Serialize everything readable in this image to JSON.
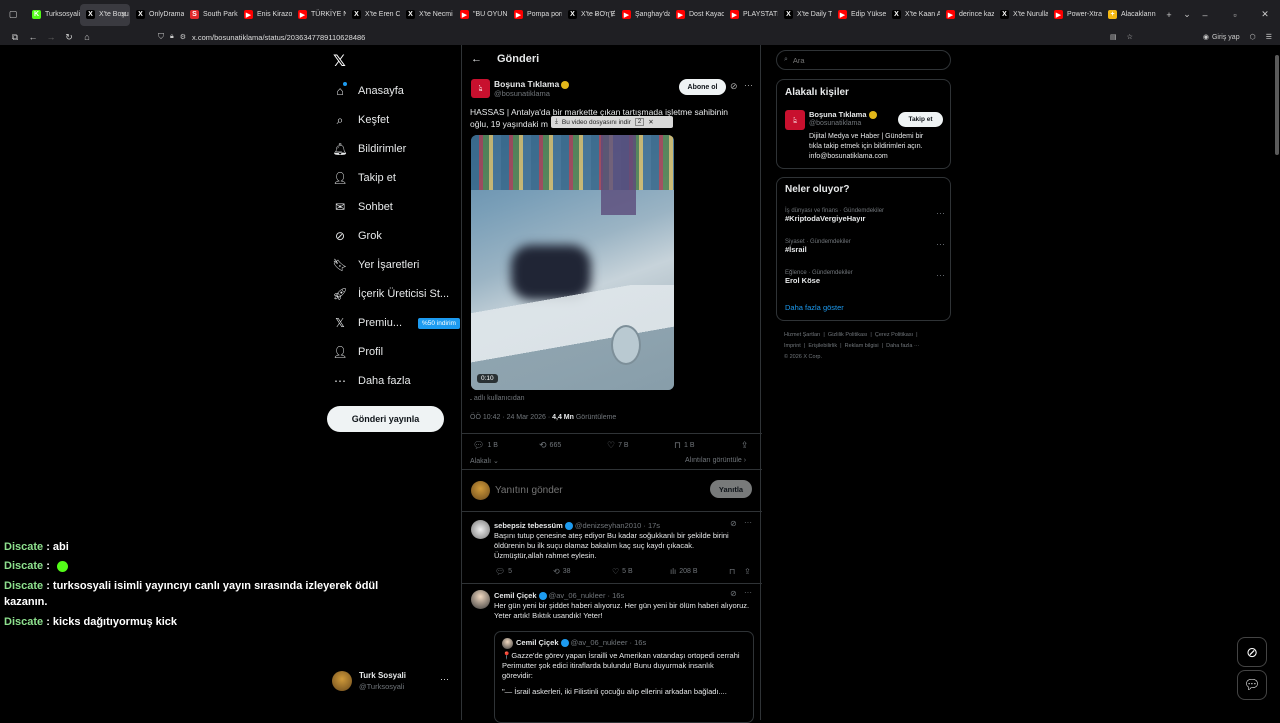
{
  "browser": {
    "tabs": [
      {
        "label": "Turksosyali",
        "color": "#53fc18",
        "glyph": "K"
      },
      {
        "label": "X'te Boşu",
        "color": "#000000",
        "glyph": "X"
      },
      {
        "label": "OnlyDrama",
        "color": "#000000",
        "glyph": "X"
      },
      {
        "label": "South Park",
        "color": "#e0282a",
        "glyph": "S"
      },
      {
        "label": "Enis Kirazoğ",
        "color": "#ff0000",
        "glyph": "▶"
      },
      {
        "label": "TÜRKİYE NA",
        "color": "#ff0000",
        "glyph": "▶"
      },
      {
        "label": "X'te Eren Ca",
        "color": "#000000",
        "glyph": "X"
      },
      {
        "label": "X'te Necmi",
        "color": "#000000",
        "glyph": "X"
      },
      {
        "label": "\"BU OYUN",
        "color": "#ff0000",
        "glyph": "▶"
      },
      {
        "label": "Pompa porn",
        "color": "#ff0000",
        "glyph": "▶"
      },
      {
        "label": "X'te ɃƠɳ'Ɇ",
        "color": "#000000",
        "glyph": "X"
      },
      {
        "label": "Şanghay'da",
        "color": "#ff0000",
        "glyph": "▶"
      },
      {
        "label": "Dost Kayaoğ",
        "color": "#ff0000",
        "glyph": "▶"
      },
      {
        "label": "PLAYSTATIC",
        "color": "#ff0000",
        "glyph": "▶"
      },
      {
        "label": "X'te Daily Tu",
        "color": "#000000",
        "glyph": "X"
      },
      {
        "label": "Edip Yüksel",
        "color": "#ff0000",
        "glyph": "▶"
      },
      {
        "label": "X'te Kaan Al",
        "color": "#000000",
        "glyph": "X"
      },
      {
        "label": "derince kaza",
        "color": "#ff0000",
        "glyph": "▶"
      },
      {
        "label": "X'te Nurulla",
        "color": "#000000",
        "glyph": "X"
      },
      {
        "label": "Power-Xtra",
        "color": "#ff0000",
        "glyph": "▶"
      },
      {
        "label": "Alacaklarını",
        "color": "#f6b913",
        "glyph": "+"
      }
    ],
    "new_tab": "+",
    "url": "x.com/bosunatiklama/status/2036347789110628486",
    "login_label": "Giriş yap"
  },
  "nav": {
    "logo": "𝕏",
    "items": [
      {
        "label": "Anasayfa",
        "icon": "home-icon"
      },
      {
        "label": "Keşfet",
        "icon": "search-icon"
      },
      {
        "label": "Bildirimler",
        "icon": "bell-icon"
      },
      {
        "label": "Takip et",
        "icon": "follow-icon"
      },
      {
        "label": "Sohbet",
        "icon": "mail-icon"
      },
      {
        "label": "Grok",
        "icon": "grok-icon"
      },
      {
        "label": "Yer İşaretleri",
        "icon": "bookmark-icon"
      },
      {
        "label": "İçerik Üreticisi St...",
        "icon": "rocket-icon"
      },
      {
        "label": "Premiu...",
        "icon": "x-icon"
      },
      {
        "label": "Profil",
        "icon": "person-icon"
      },
      {
        "label": "Daha fazla",
        "icon": "more-circle-icon"
      }
    ],
    "premium_badge": "%50 indirim",
    "post_button": "Gönderi yayınla",
    "account": {
      "name": "Turk Sosyali",
      "handle": "@Turksosyali",
      "more": "···"
    }
  },
  "header": {
    "title": "Gönderi"
  },
  "post": {
    "author_name": "Boşuna Tıklama",
    "author_handle": "@bosunatiklama",
    "subscribe": "Abone ol",
    "text_line1": "HASSAS | Antalya'da bir markette çıkan tartışmada işletme sahibinin",
    "text_line2": "oğlu, 19 yaşındaki m",
    "download_popup": "Bu video dosyasını indir",
    "download_count": "2",
    "video_time": "0:10",
    "source": "adlı kullanıcıdan",
    "timestamp": "ÖÖ 10:42 · 24 Mar 2026 · ",
    "views": "4,4 Mn",
    "views_label": " Görüntüleme",
    "stats": {
      "replies": "1 B",
      "reposts": "665",
      "likes": "7 B",
      "bookmarks": "1 B"
    },
    "related": "Alakalı",
    "quotes": "Alıntıları görüntüle"
  },
  "reply_box": {
    "placeholder": "Yanıtını gönder",
    "button": "Yanıtla"
  },
  "replies": [
    {
      "name": "sebepsiz tebessüm",
      "handle": "@denizseyhan2010 · 17s",
      "lines": [
        "Başını tutup çenesine ateş ediyor Bu kadar soğukkanlı bir şekilde birini",
        "öldürenin bu ilk suçu olamaz bakalım kaç suç kaydı çıkacak.",
        "Üzmüştür,allah rahmet eylesin."
      ],
      "stats": {
        "replies": "5",
        "reposts": "38",
        "likes": "5 B",
        "views": "208 B"
      }
    },
    {
      "name": "Cemil Çiçek",
      "handle": "@av_06_nukleer · 16s",
      "lines": [
        "Her gün yeni bir şiddet haberi alıyoruz. Her gün yeni bir ölüm haberi alıyoruz.",
        "Yeter artık! Bıktık usandık! Yeter!"
      ],
      "quote": {
        "name": "Cemil Çiçek",
        "handle": "@av_06_nukleer · 16s",
        "lines": [
          "📍Gazze'de görev yapan İsrailli ve Amerikan vatandaşı ortopedi cerrahi",
          "Perimutter şok edici itiraflarda bulundu! Bunu duyurmak insanlık",
          "görevidir:",
          "",
          "\"— İsrail askerleri, iki Filistinli çocuğu alıp ellerini arkadan bağladı...."
        ]
      }
    }
  ],
  "sidebar": {
    "search_placeholder": "Ara",
    "related_title": "Alakalı kişiler",
    "related_person": {
      "name": "Boşuna Tıklama",
      "handle": "@bosunatiklama",
      "follow": "Takip et",
      "bio": [
        "Dijital Medya ve Haber | Gündemi bir",
        "tıkla takip etmek için bildirimleri açın.",
        "info@bosunatiklama.com"
      ]
    },
    "trends_title": "Neler oluyor?",
    "trends": [
      {
        "meta": "İş dünyası ve finans · Gündemdekiler",
        "name": "#KriptodaVergiyeHayır"
      },
      {
        "meta": "Siyaset · Gündemdekiler",
        "name": "#İsrail"
      },
      {
        "meta": "Eğlence · Gündemdekiler",
        "name": "Erol Köse"
      }
    ],
    "show_more": "Daha fazla göster",
    "footer": [
      "Hizmet Şartları",
      "Gizlilik Politikası",
      "Çerez Politikası",
      "Imprint",
      "Erişilebilirlik",
      "Reklam bilgisi",
      "Daha fazla ···",
      "© 2026 X Corp."
    ]
  },
  "chat": [
    {
      "user": "Discate",
      "text": " : abi"
    },
    {
      "user": "Discate",
      "text": " : "
    },
    {
      "user": "Discate",
      "text": " : turksosyali isimli yayıncıyı canlı yayın sırasında izleyerek ödül"
    },
    {
      "user": "",
      "text": "kazanın."
    },
    {
      "user": "Discate",
      "text": " : kicks dağıtıyormuş kick"
    }
  ]
}
